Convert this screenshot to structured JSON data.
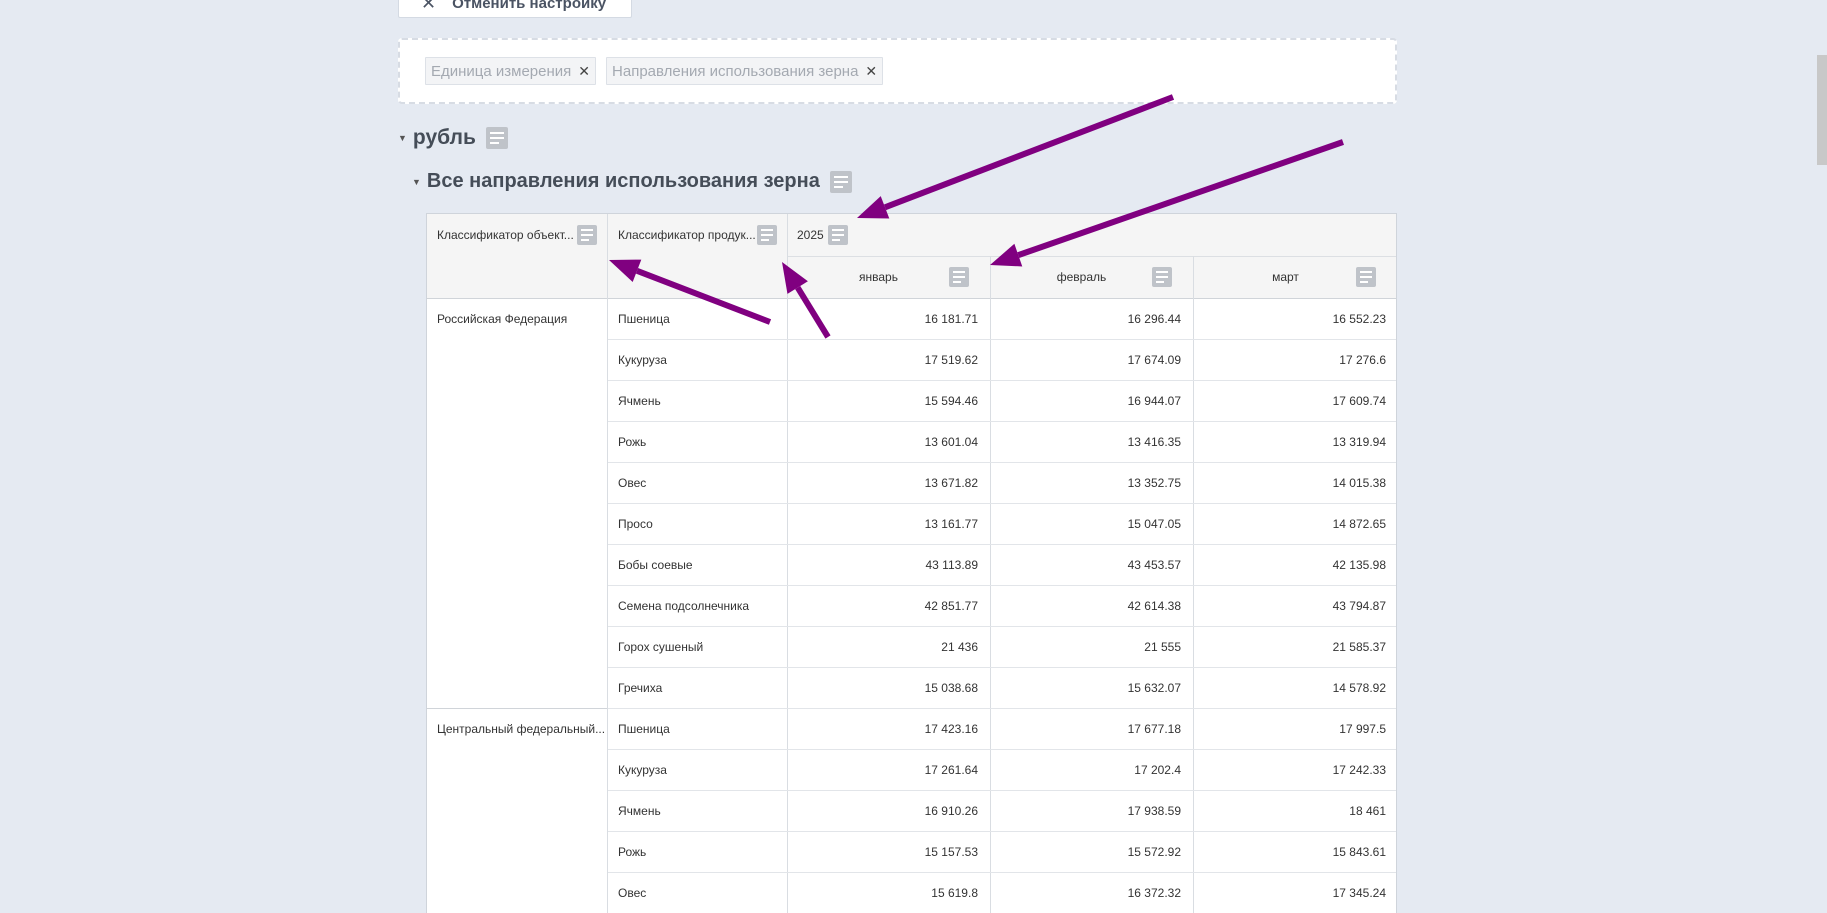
{
  "cancel_button": {
    "label": "Отменить настройку"
  },
  "filters": [
    {
      "label": "Единица измерения"
    },
    {
      "label": "Направления использования зерна"
    }
  ],
  "groups": {
    "unit": "рубль",
    "direction": "Все направления использования зерна"
  },
  "table": {
    "col_object": "Классификатор объект...",
    "col_product": "Классификатор продук...",
    "year": "2025",
    "months": [
      "январь",
      "февраль",
      "март"
    ],
    "sections": [
      {
        "region": "Российская Федерация",
        "rows": [
          {
            "product": "Пшеница",
            "values": [
              "16 181.71",
              "16 296.44",
              "16 552.23"
            ]
          },
          {
            "product": "Кукуруза",
            "values": [
              "17 519.62",
              "17 674.09",
              "17 276.6"
            ]
          },
          {
            "product": "Ячмень",
            "values": [
              "15 594.46",
              "16 944.07",
              "17 609.74"
            ]
          },
          {
            "product": "Рожь",
            "values": [
              "13 601.04",
              "13 416.35",
              "13 319.94"
            ]
          },
          {
            "product": "Овес",
            "values": [
              "13 671.82",
              "13 352.75",
              "14 015.38"
            ]
          },
          {
            "product": "Просо",
            "values": [
              "13 161.77",
              "15 047.05",
              "14 872.65"
            ]
          },
          {
            "product": "Бобы соевые",
            "values": [
              "43 113.89",
              "43 453.57",
              "42 135.98"
            ]
          },
          {
            "product": "Семена подсолнечника",
            "values": [
              "42 851.77",
              "42 614.38",
              "43 794.87"
            ]
          },
          {
            "product": "Горох сушеный",
            "values": [
              "21 436",
              "21 555",
              "21 585.37"
            ]
          },
          {
            "product": "Гречиха",
            "values": [
              "15 038.68",
              "15 632.07",
              "14 578.92"
            ]
          }
        ]
      },
      {
        "region": "Центральный федеральный...",
        "rows": [
          {
            "product": "Пшеница",
            "values": [
              "17 423.16",
              "17 677.18",
              "17 997.5"
            ]
          },
          {
            "product": "Кукуруза",
            "values": [
              "17 261.64",
              "17 202.4",
              "17 242.33"
            ]
          },
          {
            "product": "Ячмень",
            "values": [
              "16 910.26",
              "17 938.59",
              "18 461"
            ]
          },
          {
            "product": "Рожь",
            "values": [
              "15 157.53",
              "15 572.92",
              "15 843.61"
            ]
          },
          {
            "product": "Овес",
            "values": [
              "15 619.8",
              "16 372.32",
              "17 345.24"
            ]
          }
        ]
      }
    ]
  },
  "annotation": {
    "arrow_color": "#800080"
  }
}
